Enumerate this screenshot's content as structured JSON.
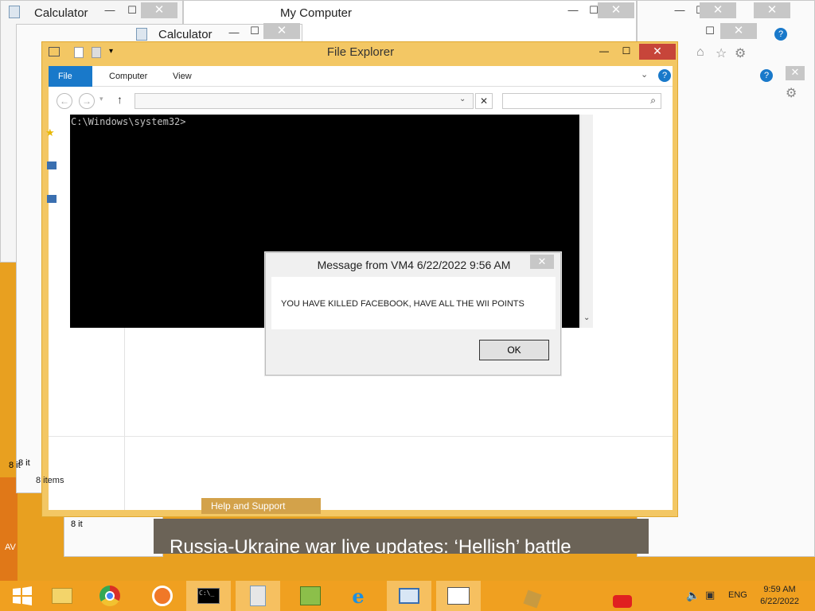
{
  "background_windows": {
    "calculator1_title": "Calculator",
    "mycomputer_title": "My Computer",
    "calculator2_title": "Calculator",
    "status_items1": "8 it",
    "status_items2": "8 it",
    "status_items3": "8 it"
  },
  "file_explorer": {
    "title": "File Explorer",
    "tabs": [
      "File",
      "Computer",
      "View"
    ],
    "address": "",
    "search_placeholder": "",
    "status": "8 items"
  },
  "console": {
    "prompt": "C:\\Windows\\system32>"
  },
  "message_box": {
    "title": "Message from VM4 6/22/2022 9:56 AM",
    "text": "YOU HAVE KILLED FACEBOOK, HAVE ALL THE WII POINTS",
    "ok_label": "OK"
  },
  "help_tab": {
    "label": "Help and Support"
  },
  "news": {
    "headline": "Russia-Ukraine war live updates: ‘Hellish’ battle"
  },
  "desktop": {
    "label": "AV"
  },
  "taskbar": {
    "items": [
      "start-icon",
      "file-explorer-icon",
      "chrome-icon",
      "avast-icon",
      "cmd-icon",
      "calculator-icon",
      "network-icon",
      "ie-icon",
      "remote-desktop-icon",
      "dialog-icon"
    ],
    "language": "ENG",
    "time": "9:59 AM",
    "date": "6/22/2022"
  },
  "colors": {
    "accent": "#f0a020",
    "file_tab": "#1979ca",
    "close_red": "#c7453a"
  }
}
